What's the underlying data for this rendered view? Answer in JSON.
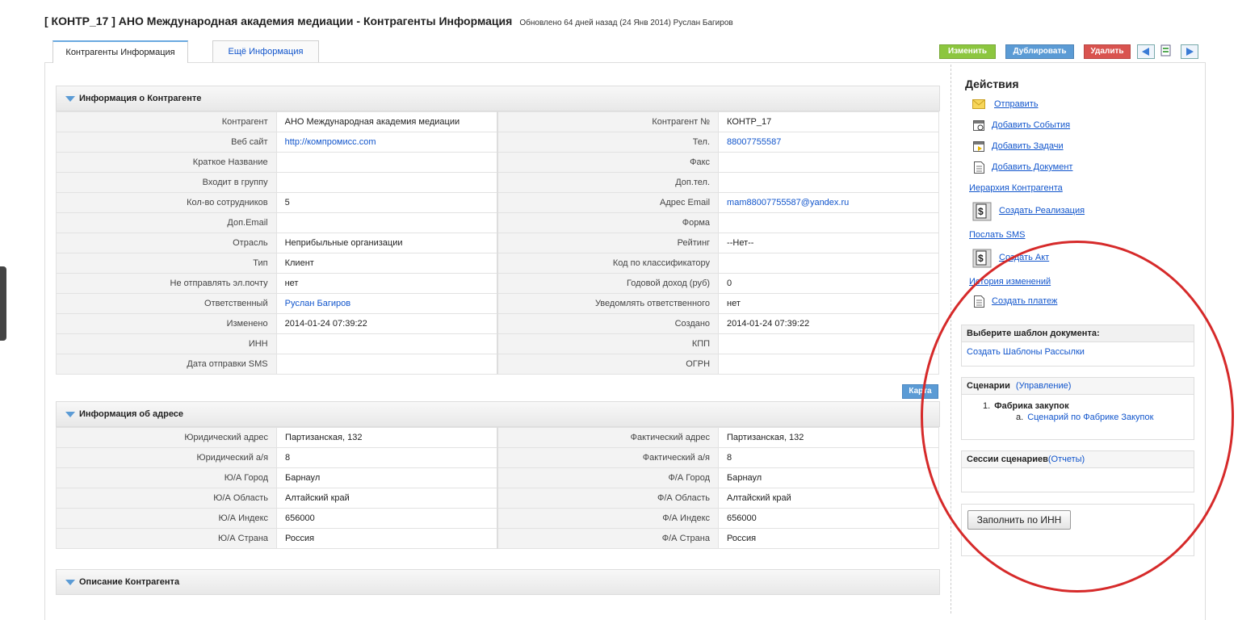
{
  "header": {
    "title": "[ КОНТР_17 ] АНО Международная академия медиации - Контрагенты Информация",
    "updated": "Обновлено 64 дней назад (24 Янв 2014) Руслан Багиров"
  },
  "tabs": [
    {
      "label": "Контрагенты Информация"
    },
    {
      "label": "Ещё Информация"
    }
  ],
  "toolbar": {
    "edit": "Изменить",
    "duplicate": "Дублировать",
    "delete": "Удалить",
    "colors": {
      "edit": "#8cc63f",
      "duplicate": "#5b9bd5",
      "delete": "#d9534f"
    }
  },
  "section1": {
    "title": "Информация о Контрагенте",
    "rows": [
      {
        "l1": "Контрагент",
        "v1": "АНО Международная академия медиации",
        "l2": "Контрагент №",
        "v2": "КОНТР_17"
      },
      {
        "l1": "Веб сайт",
        "v1": "http://компромисс.com",
        "l2": "Тел.",
        "v2": "88007755587"
      },
      {
        "l1": "Краткое Название",
        "v1": "",
        "l2": "Факс",
        "v2": ""
      },
      {
        "l1": "Входит в группу",
        "v1": "",
        "l2": "Доп.тел.",
        "v2": ""
      },
      {
        "l1": "Кол-во сотрудников",
        "v1": "5",
        "l2": "Адрес Email",
        "v2": "mam88007755587@yandex.ru"
      },
      {
        "l1": "Доп.Email",
        "v1": "",
        "l2": "Форма",
        "v2": ""
      },
      {
        "l1": "Отрасль",
        "v1": "Неприбыльные организации",
        "l2": "Рейтинг",
        "v2": "--Нет--"
      },
      {
        "l1": "Тип",
        "v1": "Клиент",
        "l2": "Код по классификатору",
        "v2": ""
      },
      {
        "l1": "Не отправлять эл.почту",
        "v1": "нет",
        "l2": "Годовой доход (руб)",
        "v2": "0"
      },
      {
        "l1": "Ответственный",
        "v1": "Руслан Багиров",
        "l2": "Уведомлять ответственного",
        "v2": "нет"
      },
      {
        "l1": "Изменено",
        "v1": "2014-01-24 07:39:22",
        "l2": "Создано",
        "v2": "2014-01-24 07:39:22"
      },
      {
        "l1": "ИНН",
        "v1": "",
        "l2": "КПП",
        "v2": ""
      },
      {
        "l1": "Дата отправки SMS",
        "v1": "",
        "l2": "ОГРН",
        "v2": ""
      }
    ]
  },
  "map_button": "Карта",
  "section2": {
    "title": "Информация об адресе",
    "rows": [
      {
        "l1": "Юридический адрес",
        "v1": "Партизанская, 132",
        "l2": "Фактический адрес",
        "v2": "Партизанская, 132"
      },
      {
        "l1": "Юридический а/я",
        "v1": "8",
        "l2": "Фактический а/я",
        "v2": "8"
      },
      {
        "l1": "Ю/А Город",
        "v1": "Барнаул",
        "l2": "Ф/А Город",
        "v2": "Барнаул"
      },
      {
        "l1": "Ю/А Область",
        "v1": "Алтайский край",
        "l2": "Ф/А Область",
        "v2": "Алтайский край"
      },
      {
        "l1": "Ю/А Индекс",
        "v1": "656000",
        "l2": "Ф/А Индекс",
        "v2": "656000"
      },
      {
        "l1": "Ю/А Страна",
        "v1": "Россия",
        "l2": "Ф/А Страна",
        "v2": "Россия"
      }
    ]
  },
  "section3": {
    "title": "Описание Контрагента"
  },
  "actions": {
    "title": "Действия",
    "send": "Отправить",
    "add_events": "Добавить События",
    "add_tasks": "Добавить Задачи",
    "add_document": "Добавить Документ",
    "hierarchy": "Иерархия Контрагента",
    "create_sale": "Создать Реализация",
    "send_sms": "Послать SMS",
    "create_act": "Создать Акт",
    "history": "История изменений",
    "create_payment": "Создать платеж"
  },
  "template_panel": {
    "title": "Выберите шаблон документа:",
    "link": "Создать Шаблоны Рассылки"
  },
  "scenarios": {
    "title": "Сценарии",
    "manage": "(Управление)",
    "item": "Фабрика закупок",
    "subitem": "Сценарий по Фабрике Закупок"
  },
  "sessions": {
    "title": "Сессии сценариев",
    "reports": "(Отчеты)"
  },
  "fill_button": "Заполнить по ИНН",
  "annotation_color": "#d62a2a"
}
